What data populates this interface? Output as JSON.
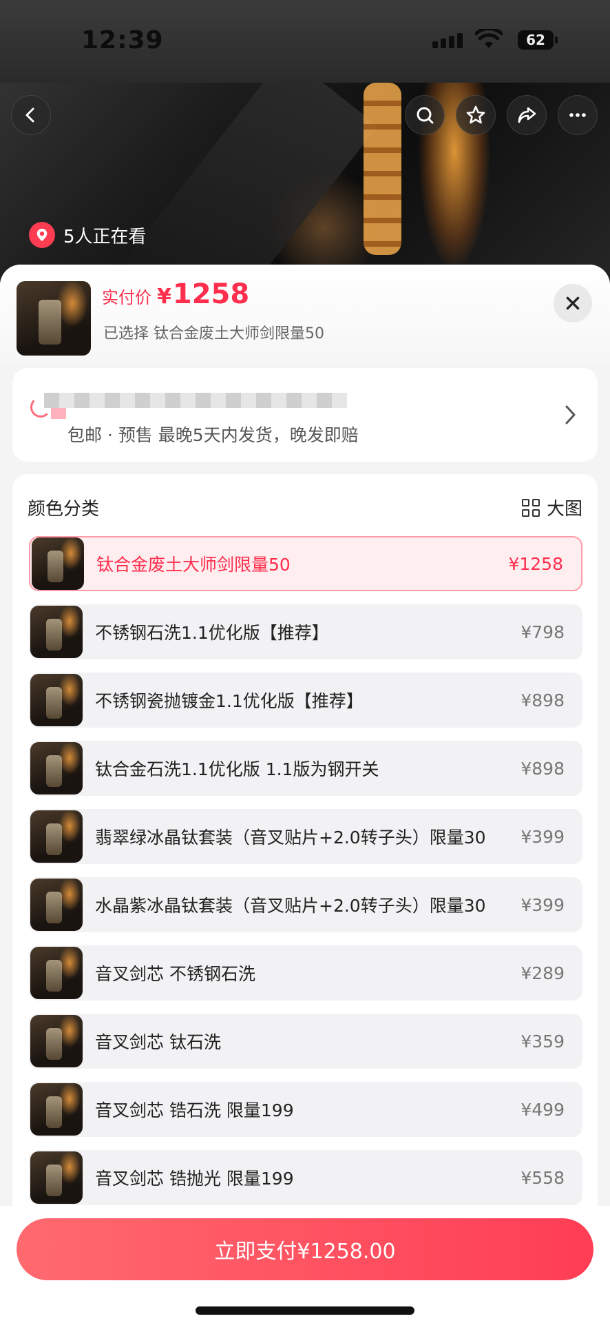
{
  "status_bar": {
    "time": "12:39",
    "battery": "62"
  },
  "hero": {
    "viewers_text": "5人正在看"
  },
  "sheet": {
    "price_label": "实付价",
    "price_currency": "¥",
    "price_value": "1258",
    "selected_text": "已选择 钛合金废土大师剑限量50",
    "shipping_text": "包邮 · 预售 最晚5天内发货，晚发即赔",
    "variants_title": "颜色分类",
    "big_image_label": "大图",
    "variants": [
      {
        "name": "钛合金废土大师剑限量50",
        "price": "¥1258",
        "selected": true
      },
      {
        "name": "不锈钢石洗1.1优化版【推荐】",
        "price": "¥798",
        "selected": false
      },
      {
        "name": "不锈钢瓷抛镀金1.1优化版【推荐】",
        "price": "¥898",
        "selected": false
      },
      {
        "name": "钛合金石洗1.1优化版 1.1版为钢开关",
        "price": "¥898",
        "selected": false
      },
      {
        "name": "翡翠绿冰晶钛套装（音叉贴片+2.0转子头）限量30",
        "price": "¥399",
        "selected": false
      },
      {
        "name": "水晶紫冰晶钛套装（音叉贴片+2.0转子头）限量30",
        "price": "¥399",
        "selected": false
      },
      {
        "name": "音叉剑芯 不锈钢石洗",
        "price": "¥289",
        "selected": false
      },
      {
        "name": "音叉剑芯 钛石洗",
        "price": "¥359",
        "selected": false
      },
      {
        "name": "音叉剑芯 锆石洗 限量199",
        "price": "¥499",
        "selected": false
      },
      {
        "name": "音叉剑芯 锆抛光 限量199",
        "price": "¥558",
        "selected": false
      }
    ]
  },
  "pay_button": {
    "label": "立即支付¥1258.00"
  },
  "colors": {
    "accent": "#ff2e4d",
    "selected_bg": "#ffeef0",
    "row_bg": "#f2f2f4"
  },
  "icons": [
    "back-icon",
    "search-icon",
    "star-icon",
    "share-icon",
    "more-icon",
    "location-icon",
    "close-icon",
    "chevron-right-icon",
    "grid-icon"
  ]
}
